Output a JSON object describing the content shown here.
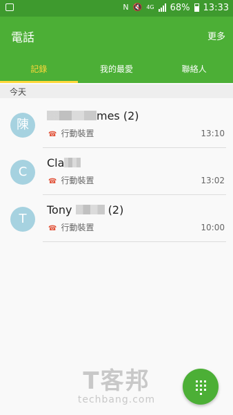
{
  "status": {
    "battery": "68%",
    "time": "13:33",
    "network": "4G"
  },
  "header": {
    "title": "電話",
    "more": "更多"
  },
  "tabs": [
    {
      "label": "記錄"
    },
    {
      "label": "我的最愛"
    },
    {
      "label": "聯絡人"
    }
  ],
  "section": {
    "label": "今天"
  },
  "calls": [
    {
      "avatar": "陳",
      "name_visible": "mes",
      "count": "(2)",
      "type": "行動裝置",
      "time": "13:10"
    },
    {
      "avatar": "C",
      "name_visible": "Cla",
      "count": "",
      "type": "行動裝置",
      "time": "13:02"
    },
    {
      "avatar": "T",
      "name_visible": "Tony",
      "count": "(2)",
      "type": "行動裝置",
      "time": "10:00"
    }
  ],
  "watermark": {
    "logo": "T客邦",
    "site": "techbang.com"
  },
  "colors": {
    "header": "#4caf36",
    "statusbar": "#3e9a2e",
    "active_tab": "#ffd83a",
    "missed_call": "#e2563d"
  }
}
